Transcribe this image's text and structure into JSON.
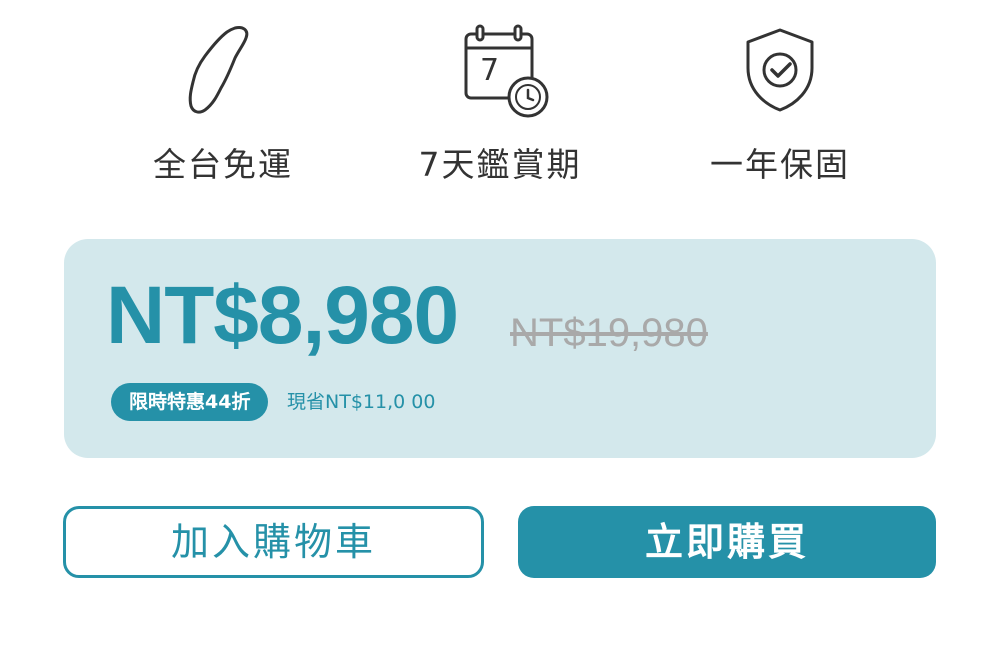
{
  "features": [
    {
      "icon": "taiwan-map-icon",
      "label": "全台免運"
    },
    {
      "icon": "calendar-clock-icon",
      "label": "7天鑑賞期",
      "calendar_number": "7"
    },
    {
      "icon": "shield-check-icon",
      "label": "一年保固"
    }
  ],
  "price": {
    "current": "NT$8,980",
    "original": "NT$19,980",
    "discount_badge": "限時特惠44折",
    "saving": "現省NT$11,0 00"
  },
  "buttons": {
    "add_to_cart": "加入購物車",
    "buy_now": "立即購買"
  },
  "colors": {
    "accent": "#2591a8",
    "price_box_bg": "#d3e8ec",
    "icon_stroke": "#333333",
    "strikethrough_price": "#a9a9a9"
  }
}
